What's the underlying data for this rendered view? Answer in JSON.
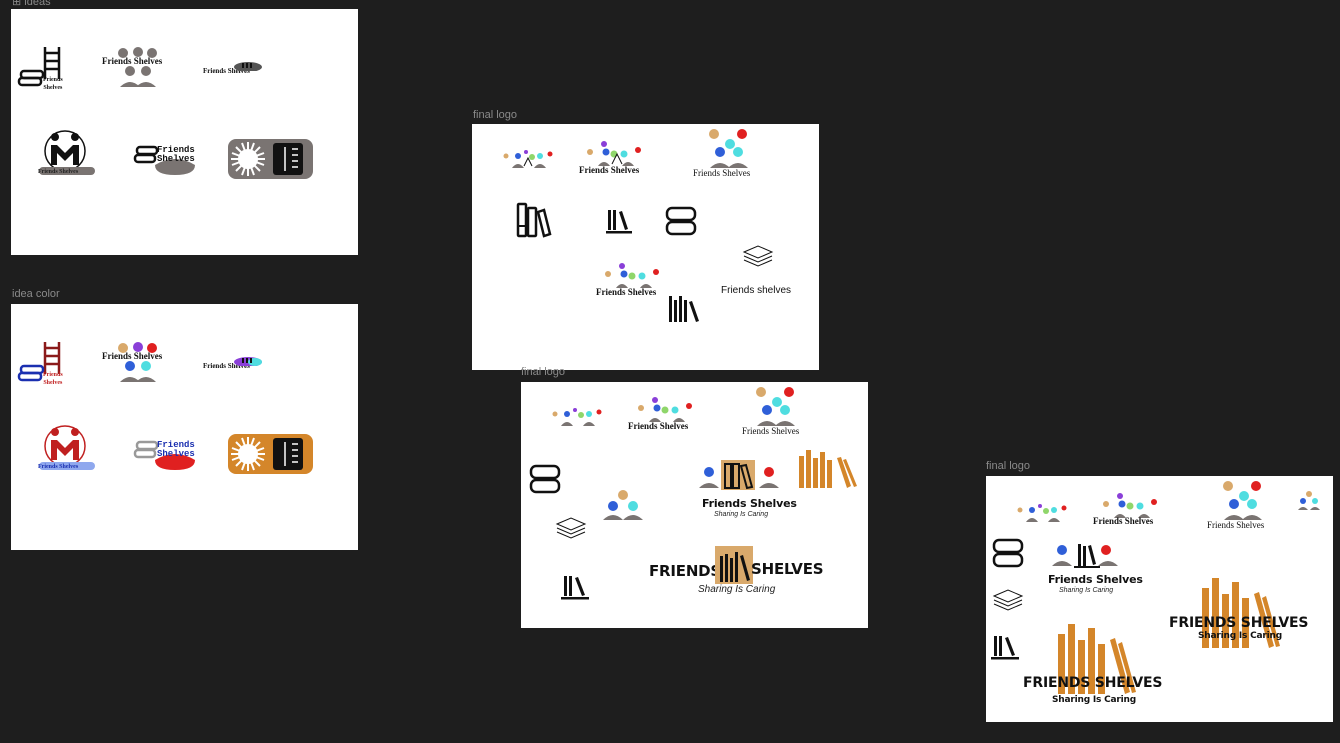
{
  "canvas": {
    "background": "#1e1e1e",
    "frame_background": "#ffffff",
    "label_color": "#8a8a8a"
  },
  "frames": {
    "ideas": {
      "label": "ideas",
      "icon": "frame-icon"
    },
    "idea_color": {
      "label": "idea color"
    },
    "final_logo_1": {
      "label": "final logo"
    },
    "final_logo_2": {
      "label": "final logo"
    },
    "final_logo_3": {
      "label": "final logo"
    }
  },
  "logo": {
    "name_title": "Friends Shelves",
    "name_lower": "Friends shelves",
    "name_caps_1": "FRIENDS",
    "name_caps_2": "SHELVES",
    "name_caps_full": "FRIENDS SHELVES",
    "word_friends": "Friends",
    "word_shelves": "Shelves",
    "tagline": "Sharing Is Caring"
  },
  "palette": {
    "ink": "#111111",
    "gray": "#7a7472",
    "tan": "#d9a96b",
    "red": "#e02020",
    "blue": "#2f5fd8",
    "cyan": "#4fdde0",
    "purple": "#8a3fd8",
    "green": "#8fd66a",
    "dark_red": "#8b1a1a",
    "orange": "#d4862a",
    "lavender": "#8fa8ee",
    "navy": "#1a2fb0"
  }
}
